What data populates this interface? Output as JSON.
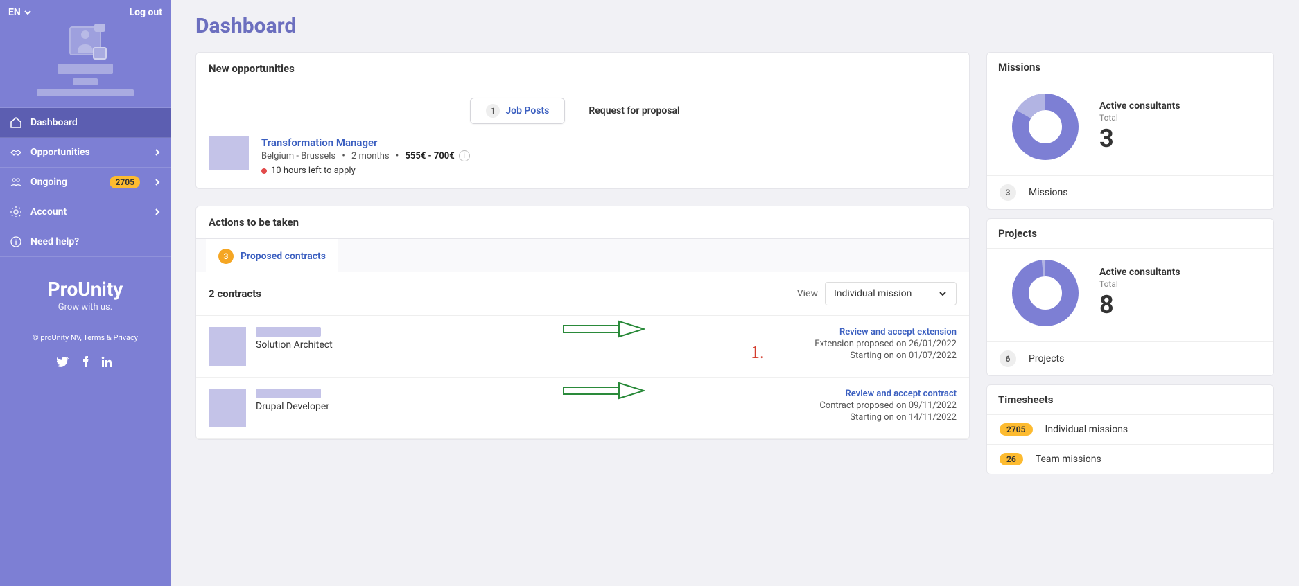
{
  "sidebar": {
    "lang": "EN",
    "logout": "Log out",
    "nav": [
      {
        "label": "Dashboard"
      },
      {
        "label": "Opportunities"
      },
      {
        "label": "Ongoing",
        "badge": "2705"
      },
      {
        "label": "Account"
      },
      {
        "label": "Need help?"
      }
    ],
    "brand_name": "ProUnity",
    "brand_tag": "Grow with us.",
    "legal_prefix": "© proUnity NV, ",
    "legal_terms": "Terms",
    "legal_amp": " & ",
    "legal_privacy": "Privacy"
  },
  "page_title": "Dashboard",
  "opportunities": {
    "header": "New opportunities",
    "tabs": {
      "job_posts_count": "1",
      "job_posts_label": "Job Posts",
      "rfp_label": "Request for proposal"
    },
    "item": {
      "title": "Transformation Manager",
      "location": "Belgium - Brussels",
      "duration": "2 months",
      "rate": "555€ - 700€",
      "deadline": "10 hours left to apply"
    }
  },
  "actions": {
    "header": "Actions to be taken",
    "tab_count": "3",
    "tab_label": "Proposed contracts",
    "contracts_title": "2 contracts",
    "view_label": "View",
    "view_value": "Individual mission",
    "contracts": [
      {
        "role": "Solution Architect",
        "action": "Review and accept extension",
        "line1": "Extension proposed on 26/01/2022",
        "line2": "Starting on on 01/07/2022"
      },
      {
        "role": "Drupal Developer",
        "action": "Review and accept contract",
        "line1": "Contract proposed on 09/11/2022",
        "line2": "Starting on on 14/11/2022"
      }
    ],
    "annotation": "1."
  },
  "missions": {
    "title": "Missions",
    "stat_label": "Active consultants",
    "stat_sub": "Total",
    "stat_num": "3",
    "sub_count": "3",
    "sub_label": "Missions"
  },
  "projects": {
    "title": "Projects",
    "stat_label": "Active consultants",
    "stat_sub": "Total",
    "stat_num": "8",
    "sub_count": "6",
    "sub_label": "Projects"
  },
  "timesheets": {
    "title": "Timesheets",
    "rows": [
      {
        "badge": "2705",
        "label": "Individual missions"
      },
      {
        "badge": "26",
        "label": "Team missions"
      }
    ]
  }
}
